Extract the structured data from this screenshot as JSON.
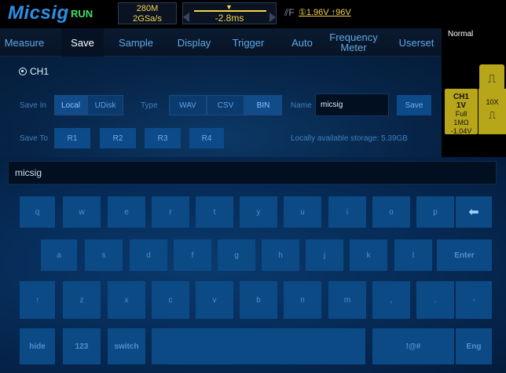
{
  "status": {
    "logo": "Micsig",
    "run_state": "RUN",
    "memory_depth": "280M",
    "sample_rate": "2GSa/s",
    "time_offset": "-2.8ms",
    "trigger_level": "1.96V",
    "trigger_display": "①1.96V ↑96V"
  },
  "tabs": [
    {
      "label": "Measure",
      "active": false
    },
    {
      "label": "Save",
      "active": true
    },
    {
      "label": "Sample",
      "active": false
    },
    {
      "label": "Display",
      "active": false
    },
    {
      "label": "Trigger",
      "active": false
    },
    {
      "label": "Auto",
      "active": false
    },
    {
      "label": "Frequency Meter",
      "active": false
    },
    {
      "label": "Userset",
      "active": false
    }
  ],
  "mode": "Normal",
  "channel": {
    "label": "CH1",
    "scale": "1V",
    "bandwidth": "Full",
    "impedance": "1MΩ",
    "offset": "-1.04V",
    "probe": "10X"
  },
  "save": {
    "radio_label": "CH1",
    "save_in_label": "Save In",
    "save_in_options": [
      "Local",
      "UDisk"
    ],
    "save_in_selected": "Local",
    "type_label": "Type",
    "type_options": [
      "WAV",
      "CSV",
      "BIN"
    ],
    "type_selected": "BIN",
    "name_label": "Name",
    "name_value": "micsig",
    "save_button": "Save",
    "save_to_label": "Save To",
    "save_to_options": [
      "R1",
      "R2",
      "R3",
      "R4"
    ],
    "storage_text": "Locally available storage: 5.39GB"
  },
  "keyboard": {
    "input_value": "micsig",
    "rows": [
      [
        "q",
        "w",
        "e",
        "r",
        "t",
        "y",
        "u",
        "i",
        "o",
        "p",
        "⬅"
      ],
      [
        "a",
        "s",
        "d",
        "f",
        "g",
        "h",
        "j",
        "k",
        "l",
        "Enter"
      ],
      [
        "↑",
        "z",
        "x",
        "c",
        "v",
        "b",
        "n",
        "m",
        ",",
        ".",
        "-"
      ],
      [
        "hide",
        "123",
        "switch",
        "",
        "!@#",
        "Eng"
      ]
    ]
  },
  "colors": {
    "accent": "#2d8fe6",
    "run": "#3ee06a",
    "trigger": "#f5d34a",
    "channel": "#b7a51a"
  }
}
